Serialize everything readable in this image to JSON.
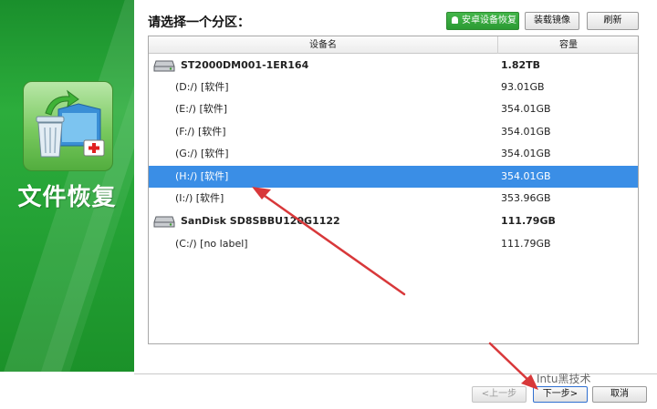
{
  "side": {
    "title": "文件恢复",
    "icon": "recycle-bin-recovery-icon",
    "colors": {
      "panel": "#2cad3c",
      "icon_bg": "#79c95f"
    }
  },
  "header": {
    "prompt": "请选择一个分区：",
    "android_btn": "安卓设备恢复",
    "mount_btn": "装载镜像",
    "refresh_btn": "刷新"
  },
  "table": {
    "columns": {
      "name": "设备名",
      "capacity": "容量"
    },
    "rows": [
      {
        "type": "disk",
        "name": "ST2000DM001-1ER164",
        "capacity": "1.82TB"
      },
      {
        "type": "partition",
        "name": "(D:/) [软件]",
        "capacity": "93.01GB"
      },
      {
        "type": "partition",
        "name": "(E:/) [软件]",
        "capacity": "354.01GB"
      },
      {
        "type": "partition",
        "name": "(F:/) [软件]",
        "capacity": "354.01GB"
      },
      {
        "type": "partition",
        "name": "(G:/) [软件]",
        "capacity": "354.01GB"
      },
      {
        "type": "partition",
        "name": "(H:/) [软件]",
        "capacity": "354.01GB",
        "selected": true
      },
      {
        "type": "partition",
        "name": "(I:/) [软件]",
        "capacity": "353.96GB"
      },
      {
        "type": "disk",
        "name": "SanDisk SD8SBBU120G1122",
        "capacity": "111.79GB"
      },
      {
        "type": "partition",
        "name": "(C:/) [no label]",
        "capacity": "111.79GB"
      }
    ],
    "selection_color": "#3a8ee6"
  },
  "footer": {
    "prev": "<上一步",
    "next": "下一步>",
    "cancel": "取消"
  },
  "watermark": "Intu黑技术"
}
